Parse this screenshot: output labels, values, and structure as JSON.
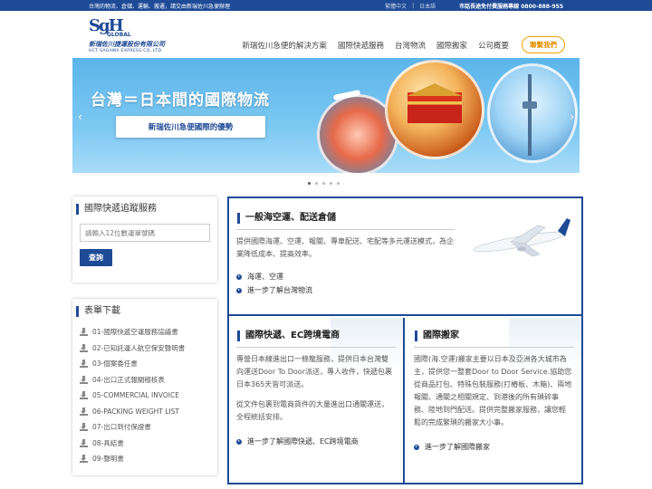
{
  "topbar": {
    "notice": "台灣的物流、倉儲、運輸、搬遷，請交由新瑞佐川急便辦理",
    "lang_zh": "繁體中文",
    "lang_jp": "日本語",
    "hotline": "市話長途免付費服務專線 0800-888-955"
  },
  "logo": {
    "mark": "SgH",
    "global": "GLOBAL",
    "name_zh": "新瑞佐川捷運股份有限公司",
    "name_en": "HCT SAGAWA EXPRESS CO.,LTD."
  },
  "nav": {
    "items": [
      "新瑞佐川急便的解決方案",
      "國際快遞服務",
      "台灣物流",
      "國際搬家",
      "公司概要"
    ],
    "contact": "聯繫我們"
  },
  "banner": {
    "title": "台灣＝日本間的國際物流",
    "button": "新瑞佐川急便國際的優勢",
    "prev": "‹",
    "next": "›"
  },
  "tracking": {
    "title": "國際快遞追蹤服務",
    "placeholder": "請輸入12位數運單號碼",
    "search": "查詢"
  },
  "forms": {
    "title": "表單下載",
    "items": [
      "01-國際快遞空運服務協議書",
      "02-已知託運人航空保安聲明書",
      "03-個案委任書",
      "04-出口正式報關稽核表",
      "05-COMMERCIAL INVOICE",
      "06-PACKING WEIGHT LIST",
      "07-出口到付保證書",
      "08-具結書",
      "09-聲明書"
    ]
  },
  "panels": {
    "air_sea": {
      "title": "一般海空運、配送倉儲",
      "desc": "提供國際海運、空運、報關、專車配送、宅配等多元運送模式，為企業降低成本、提高效率。",
      "links": [
        "海運、空運",
        "進一步了解台灣物流"
      ]
    },
    "ec": {
      "title": "國際快遞、EC跨境電商",
      "desc1": "專營日本線進出口一條龍服務，提供日本台灣雙向運送Door To Door派送，專人收件，快遞包裹日本365天皆可派送。",
      "desc2": "從文件包裹到電商貨件的大量進出口通關運送，全程統括安排。",
      "link": "進一步了解國際快遞、EC跨境電商"
    },
    "moving": {
      "title": "國際搬家",
      "desc": "國際(海.空運)搬家主要以日本及亞洲各大城市為主，提供您一整套Door to Door Service.協助您從商品打包、特殊包裝服務(打樁板、木箱)、兩地報關、通關之相關規定、到港後的所有瑣碎事務、陸地到門配送。提供完整搬家服務，讓您輕鬆的完成繁瑣的搬家大小事。",
      "link": "進一步了解國際搬家"
    }
  }
}
